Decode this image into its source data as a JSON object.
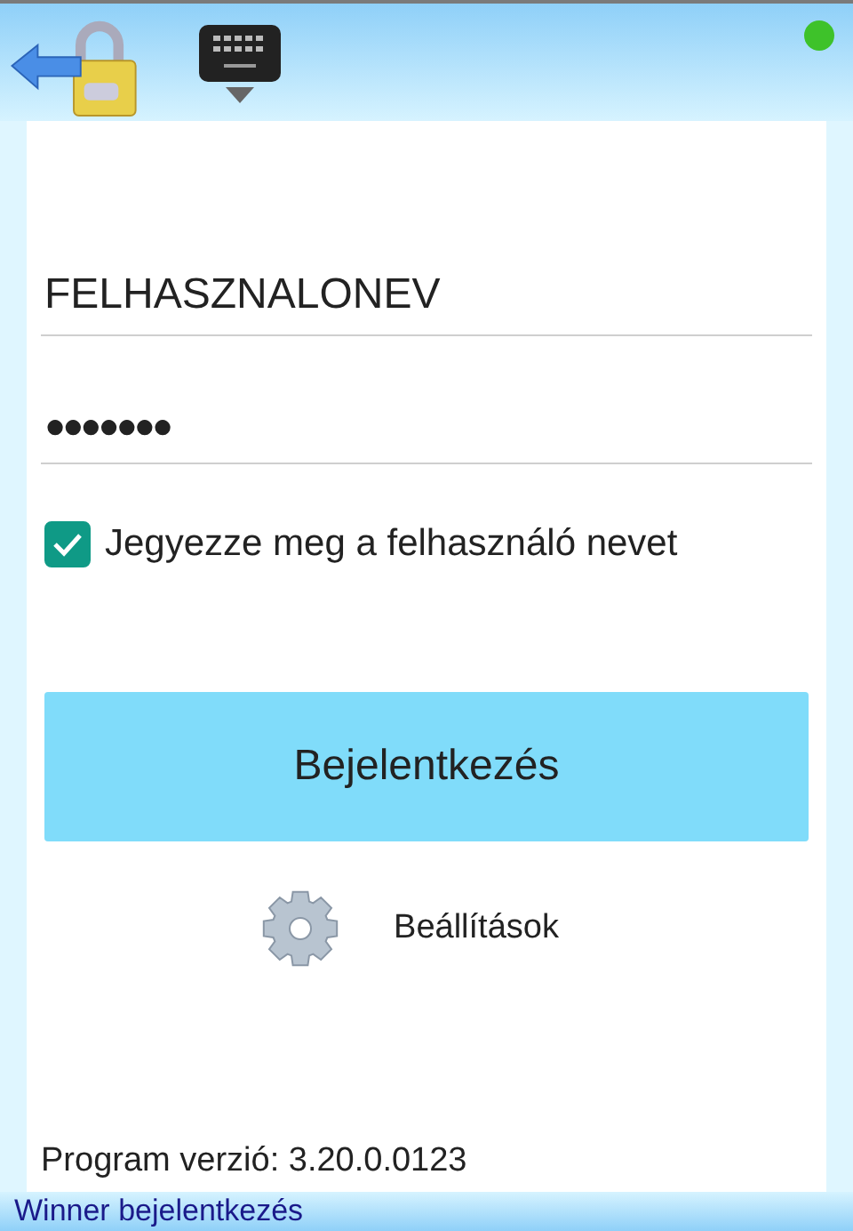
{
  "toolbar": {
    "online": true
  },
  "form": {
    "username": "FELHASZNALONEV",
    "password": "●●●●●●●",
    "remember": {
      "label": "Jegyezze meg a felhasználó nevet",
      "checked": true
    },
    "login_button": "Bejelentkezés",
    "settings": "Beállítások",
    "version": "Program verzió: 3.20.0.0123"
  },
  "status_bar": "Winner bejelentkezés"
}
